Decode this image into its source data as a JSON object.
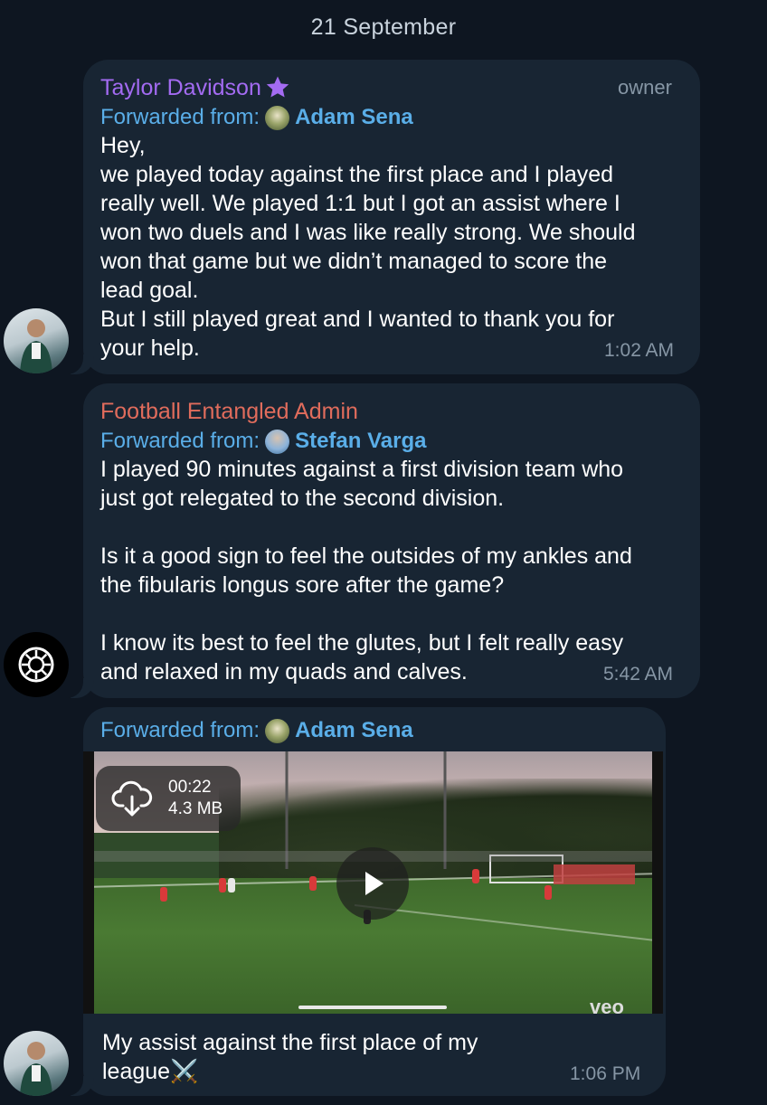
{
  "chat": {
    "date_separator": "21 September"
  },
  "messages": [
    {
      "sender": "Taylor Davidson",
      "sender_badge": "⭐",
      "sender_color": "#a36bf2",
      "role": "owner",
      "forwarded_label": "Forwarded from:",
      "forwarded_name": "Adam Sena",
      "text": "Hey,\nwe played today against the first place and I played\nreally well. We played 1:1 but I got an assist where I\nwon two duels and I was like really strong. We should\nwon that game but we didn’t managed to score the\nlead goal.\nBut I still played great and I wanted to thank you for\nyour help.",
      "time": "1:02 AM",
      "avatar": "person-avatar"
    },
    {
      "sender": "Football Entangled Admin",
      "sender_color": "#e06c5c",
      "forwarded_label": "Forwarded from:",
      "forwarded_name": "Stefan Varga",
      "text": "I played 90 minutes against a first division team who\njust got relegated to the second division.\n\nIs it a good sign to feel the outsides of my ankles and\nthe fibularis longus sore after the game?\n\nI know its best to feel the glutes, but I felt really easy\nand relaxed in my quads and calves.",
      "time": "5:42 AM",
      "avatar": "logo-avatar"
    },
    {
      "forwarded_label": "Forwarded from:",
      "forwarded_name": "Adam Sena",
      "video": {
        "duration": "00:22",
        "size": "4.3 MB",
        "download_icon": "cloud-download-icon",
        "play_icon": "play-icon",
        "watermark": "veo"
      },
      "text": "My assist against the first place of my\nleague⚔️",
      "time": "1:06 PM",
      "avatar": "person-avatar"
    }
  ],
  "colors": {
    "background": "#0e1621",
    "bubble": "#182533",
    "link": "#5aaee8",
    "meta": "#8696a5"
  }
}
